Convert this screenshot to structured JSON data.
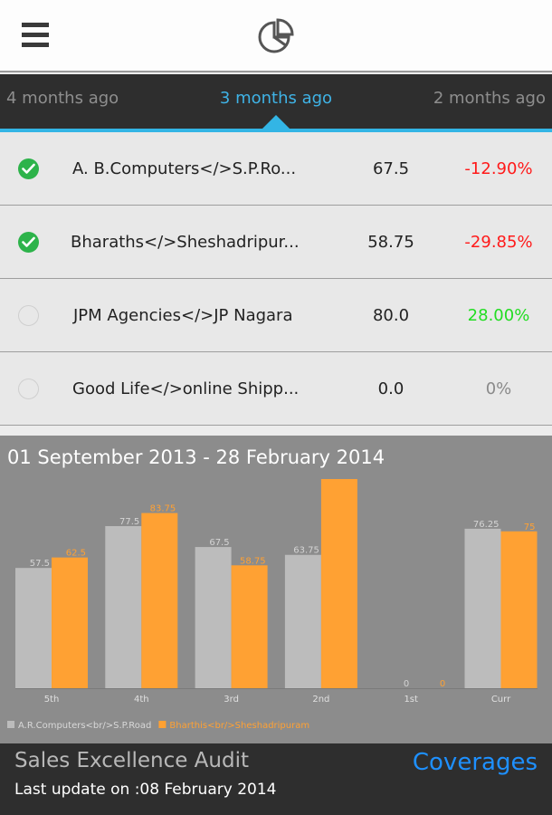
{
  "header": {
    "menu_icon": "hamburger-menu-icon",
    "logo_icon": "pie-chart-icon"
  },
  "tabs": [
    {
      "label": "4 months ago",
      "active": false
    },
    {
      "label": "3 months ago",
      "active": true
    },
    {
      "label": "2 months ago",
      "active": false
    }
  ],
  "colors": {
    "accent": "#33b5e5",
    "negative": "#ff1a1a",
    "positive": "#22dd22",
    "neutral": "#8a8a8a",
    "check": "#2db34a",
    "series_a": "#bcbcbc",
    "series_b": "#ffa133"
  },
  "rows": [
    {
      "checked": true,
      "name": "A. B.Computers</>S.P.Ro...",
      "value": "67.5",
      "change": "-12.90%",
      "trend": "negative"
    },
    {
      "checked": true,
      "name": "Bharaths</>Sheshadripur...",
      "value": "58.75",
      "change": "-29.85%",
      "trend": "negative"
    },
    {
      "checked": false,
      "name": "JPM Agencies</>JP Nagara",
      "value": "80.0",
      "change": "28.00%",
      "trend": "positive"
    },
    {
      "checked": false,
      "name": "Good Life</>online Shipp...",
      "value": "0.0",
      "change": "0%",
      "trend": "neutral"
    }
  ],
  "chart_title": "01 September 2013 - 28 February 2014",
  "chart_data": {
    "type": "bar",
    "title": "01 September 2013 - 28 February 2014",
    "categories": [
      "5th",
      "4th",
      "3rd",
      "2nd",
      "1st",
      "Curr"
    ],
    "ylim": [
      0,
      100
    ],
    "grid": false,
    "legend": "bottom-left",
    "series": [
      {
        "name": "A.R.Computers<br/>S.P.Road",
        "values": [
          57.5,
          77.5,
          67.5,
          63.75,
          0,
          76.25
        ],
        "labels": [
          "57.5",
          "77.5",
          "67.5",
          "63.75",
          "0",
          "76.25"
        ],
        "color": "#bcbcbc"
      },
      {
        "name": "Bharthis<br/>Sheshadripuram",
        "values": [
          62.5,
          83.75,
          58.75,
          100,
          0,
          75
        ],
        "labels": [
          "62.5",
          "83.75",
          "58.75",
          "",
          "0",
          "75"
        ],
        "color": "#ffa133"
      }
    ]
  },
  "footer": {
    "title": "Sales Excellence Audit",
    "last_update": "Last update on :08 February 2014",
    "link": "Coverages"
  }
}
